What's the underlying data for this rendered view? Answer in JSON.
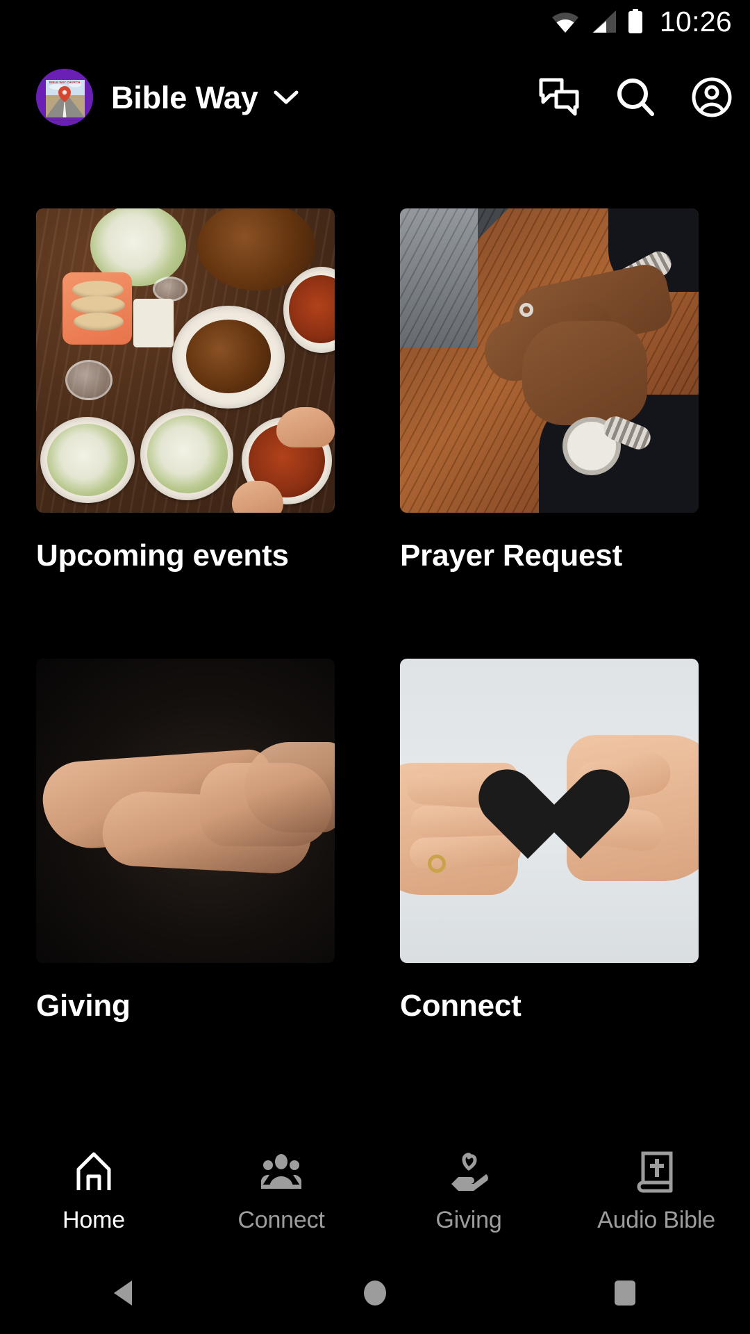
{
  "status_bar": {
    "wifi_icon": "wifi-icon",
    "cellular_icon": "cellular-signal-icon",
    "battery_icon": "battery-full-icon",
    "time": "10:26"
  },
  "app_header": {
    "avatar": {
      "icon": "church-avatar",
      "ring_color": "#6a1fb5",
      "artwork_text": "BIBLE WAY CHURCH"
    },
    "org_name": "Bible Way",
    "dropdown_icon": "chevron-down-icon",
    "actions": [
      {
        "icon": "messages-icon",
        "name": "messages-button"
      },
      {
        "icon": "search-icon",
        "name": "search-button"
      },
      {
        "icon": "account-circle-icon",
        "name": "account-button"
      }
    ]
  },
  "cards": [
    {
      "title": "Upcoming events",
      "image": "table-of-food-photo",
      "name": "card-upcoming-events"
    },
    {
      "title": "Prayer Request",
      "image": "clasped-hands-on-table-photo",
      "name": "card-prayer-request"
    },
    {
      "title": "Giving",
      "image": "open-cupped-hands-photo",
      "name": "card-giving"
    },
    {
      "title": "Connect",
      "image": "hands-exchanging-paper-heart-photo",
      "name": "card-connect"
    }
  ],
  "bottom_nav": {
    "active_index": 0,
    "items": [
      {
        "label": "Home",
        "icon": "church-home-icon",
        "active": true
      },
      {
        "label": "Connect",
        "icon": "people-group-icon",
        "active": false
      },
      {
        "label": "Giving",
        "icon": "hand-heart-icon",
        "active": false
      },
      {
        "label": "Audio Bible",
        "icon": "bible-book-icon",
        "active": false
      }
    ]
  },
  "system_nav": {
    "back": "back-triangle-icon",
    "home": "home-circle-icon",
    "recents": "recents-square-icon"
  },
  "colors": {
    "background": "#000000",
    "text_primary": "#ffffff",
    "text_muted": "#9d9d9d",
    "brand_purple": "#6a1fb5"
  }
}
